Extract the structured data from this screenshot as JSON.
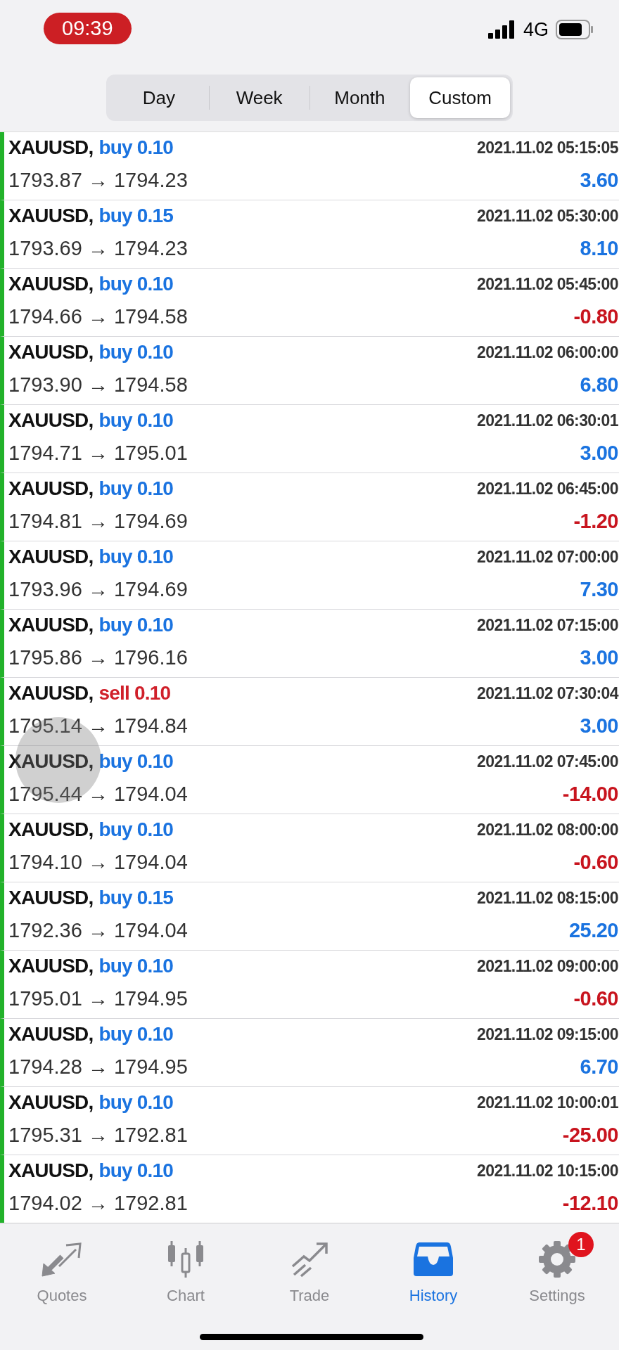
{
  "status_bar": {
    "time": "09:39",
    "network": "4G"
  },
  "periods": [
    {
      "label": "Day",
      "selected": false
    },
    {
      "label": "Week",
      "selected": false
    },
    {
      "label": "Month",
      "selected": false
    },
    {
      "label": "Custom",
      "selected": true
    }
  ],
  "deals": [
    {
      "symbol": "XAUUSD,",
      "kind": "buy",
      "deal": "buy 0.10",
      "time": "2021.11.02 05:15:05",
      "prices": "1793.87 → 1794.23",
      "profit": "3.60",
      "loss": false
    },
    {
      "symbol": "XAUUSD,",
      "kind": "buy",
      "deal": "buy 0.15",
      "time": "2021.11.02 05:30:00",
      "prices": "1793.69 → 1794.23",
      "profit": "8.10",
      "loss": false
    },
    {
      "symbol": "XAUUSD,",
      "kind": "buy",
      "deal": "buy 0.10",
      "time": "2021.11.02 05:45:00",
      "prices": "1794.66 → 1794.58",
      "profit": "-0.80",
      "loss": true
    },
    {
      "symbol": "XAUUSD,",
      "kind": "buy",
      "deal": "buy 0.10",
      "time": "2021.11.02 06:00:00",
      "prices": "1793.90 → 1794.58",
      "profit": "6.80",
      "loss": false
    },
    {
      "symbol": "XAUUSD,",
      "kind": "buy",
      "deal": "buy 0.10",
      "time": "2021.11.02 06:30:01",
      "prices": "1794.71 → 1795.01",
      "profit": "3.00",
      "loss": false
    },
    {
      "symbol": "XAUUSD,",
      "kind": "buy",
      "deal": "buy 0.10",
      "time": "2021.11.02 06:45:00",
      "prices": "1794.81 → 1794.69",
      "profit": "-1.20",
      "loss": true
    },
    {
      "symbol": "XAUUSD,",
      "kind": "buy",
      "deal": "buy 0.10",
      "time": "2021.11.02 07:00:00",
      "prices": "1793.96 → 1794.69",
      "profit": "7.30",
      "loss": false
    },
    {
      "symbol": "XAUUSD,",
      "kind": "buy",
      "deal": "buy 0.10",
      "time": "2021.11.02 07:15:00",
      "prices": "1795.86 → 1796.16",
      "profit": "3.00",
      "loss": false
    },
    {
      "symbol": "XAUUSD,",
      "kind": "sell",
      "deal": "sell 0.10",
      "time": "2021.11.02 07:30:04",
      "prices": "1795.14 → 1794.84",
      "profit": "3.00",
      "loss": false
    },
    {
      "symbol": "XAUUSD,",
      "kind": "buy",
      "deal": "buy 0.10",
      "time": "2021.11.02 07:45:00",
      "prices": "1795.44 → 1794.04",
      "profit": "-14.00",
      "loss": true
    },
    {
      "symbol": "XAUUSD,",
      "kind": "buy",
      "deal": "buy 0.10",
      "time": "2021.11.02 08:00:00",
      "prices": "1794.10 → 1794.04",
      "profit": "-0.60",
      "loss": true
    },
    {
      "symbol": "XAUUSD,",
      "kind": "buy",
      "deal": "buy 0.15",
      "time": "2021.11.02 08:15:00",
      "prices": "1792.36 → 1794.04",
      "profit": "25.20",
      "loss": false
    },
    {
      "symbol": "XAUUSD,",
      "kind": "buy",
      "deal": "buy 0.10",
      "time": "2021.11.02 09:00:00",
      "prices": "1795.01 → 1794.95",
      "profit": "-0.60",
      "loss": true
    },
    {
      "symbol": "XAUUSD,",
      "kind": "buy",
      "deal": "buy 0.10",
      "time": "2021.11.02 09:15:00",
      "prices": "1794.28 → 1794.95",
      "profit": "6.70",
      "loss": false
    },
    {
      "symbol": "XAUUSD,",
      "kind": "buy",
      "deal": "buy 0.10",
      "time": "2021.11.02 10:00:01",
      "prices": "1795.31 → 1792.81",
      "profit": "-25.00",
      "loss": true
    },
    {
      "symbol": "XAUUSD,",
      "kind": "buy",
      "deal": "buy 0.10",
      "time": "2021.11.02 10:15:00",
      "prices": "1794.02 → 1792.81",
      "profit": "-12.10",
      "loss": true
    }
  ],
  "tab_bar": [
    {
      "kind": "quotes",
      "label": "Quotes",
      "selected": false
    },
    {
      "kind": "chart",
      "label": "Chart",
      "selected": false
    },
    {
      "kind": "trade",
      "label": "Trade",
      "selected": false
    },
    {
      "kind": "history",
      "label": "History",
      "selected": true
    },
    {
      "kind": "settings",
      "label": "Settings",
      "selected": false,
      "badge": "1"
    }
  ]
}
